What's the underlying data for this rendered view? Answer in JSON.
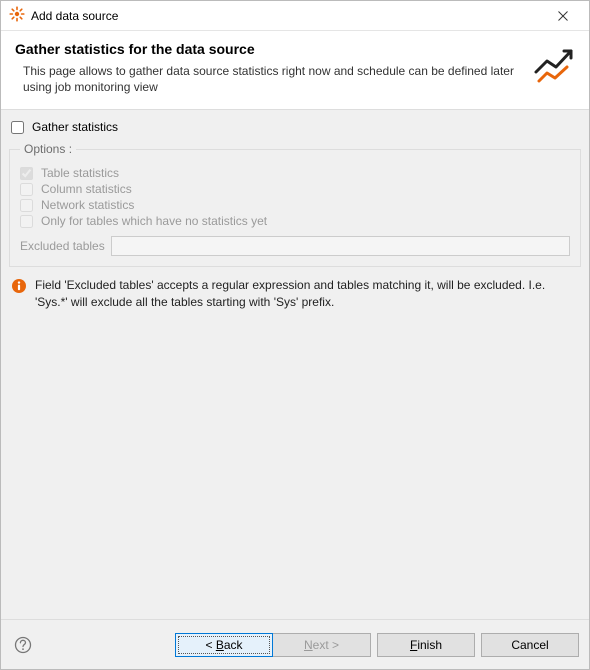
{
  "titlebar": {
    "title": "Add data source"
  },
  "banner": {
    "title": "Gather statistics for the data source",
    "desc": "This page allows to gather data source statistics right now and schedule can be defined later using job monitoring view"
  },
  "gather": {
    "label": "Gather statistics",
    "checked": false
  },
  "options": {
    "legend": "Options :",
    "table": {
      "label": "Table statistics",
      "checked": true,
      "enabled": false
    },
    "column": {
      "label": "Column statistics",
      "checked": false,
      "enabled": false
    },
    "network": {
      "label": "Network statistics",
      "checked": false,
      "enabled": false
    },
    "only_no_stats": {
      "label": "Only for tables which have no statistics yet",
      "checked": false,
      "enabled": false
    },
    "excluded_label": "Excluded tables",
    "excluded_value": ""
  },
  "info": {
    "text": "Field 'Excluded tables' accepts a regular expression and tables matching it, will be excluded. I.e. 'Sys.*' will exclude all the tables starting with 'Sys' prefix."
  },
  "footer": {
    "back": "< Back",
    "next": "Next >",
    "finish": "Finish",
    "cancel": "Cancel"
  }
}
